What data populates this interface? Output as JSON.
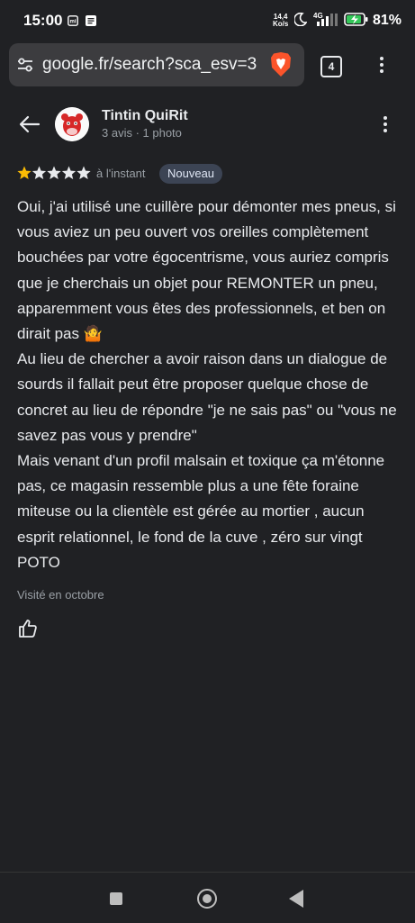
{
  "status": {
    "time": "15:00",
    "net_speed_value": "14,4",
    "net_speed_unit": "Ko/s",
    "network": "4G",
    "battery": "81%"
  },
  "browser": {
    "url": "google.fr/search?sca_esv=3",
    "tab_count": "4"
  },
  "review": {
    "reviewer_name": "Tintin QuiRit",
    "reviewer_meta": "3 avis · 1 photo",
    "rating": 1,
    "rating_max": 5,
    "time_ago": "à l'instant",
    "badge": "Nouveau",
    "text": "Oui, j'ai utilisé une cuillère pour démonter mes pneus, si vous aviez un peu ouvert vos oreilles complètement bouchées par votre égocentrisme, vous auriez compris que je cherchais un objet pour REMONTER un pneu, apparemment vous êtes des professionnels, et ben on dirait pas 🤷\nAu lieu de chercher a avoir raison dans un dialogue de sourds il fallait peut être proposer quelque chose de concret au lieu de répondre \"je ne sais pas\" ou \"vous ne savez pas vous y prendre\"\nMais venant d'un profil malsain et toxique ça m'étonne pas, ce magasin ressemble plus a une fête foraine miteuse ou la clientèle est gérée au mortier , aucun esprit relationnel, le fond de la cuve , zéro sur vingt POTO",
    "visit_info": "Visité en octobre"
  },
  "colors": {
    "background": "#202124",
    "star_filled": "#fbbc04",
    "star_empty": "#e8eaed",
    "badge_bg": "#3c4454",
    "brave_orange": "#fb542b"
  }
}
